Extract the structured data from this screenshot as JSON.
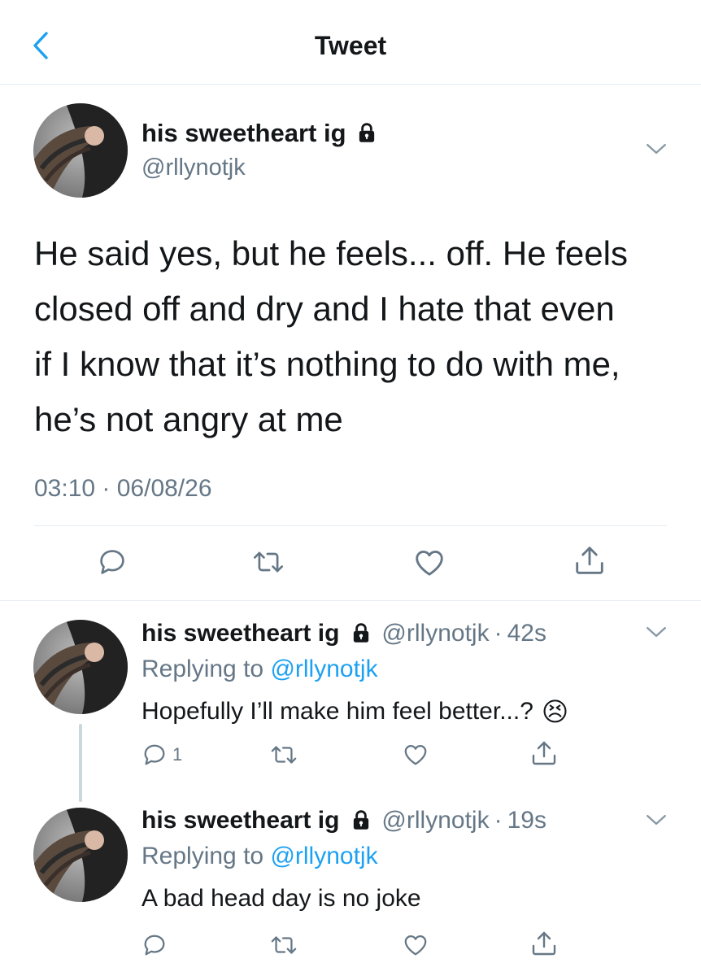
{
  "header": {
    "title": "Tweet"
  },
  "tweet": {
    "author_name": "his sweetheart ig",
    "author_handle": "@rllynotjk",
    "text": "He said yes, but he feels... off. He feels\nclosed off and dry and I hate that even\nif I know that it’s nothing to do with me,\nhe’s not angry at me",
    "timestamp": "03:10 · 06/08/26"
  },
  "replies": [
    {
      "author_name": "his sweetheart ig",
      "author_handle": "@rllynotjk",
      "dot": "·",
      "time": "42s",
      "replying_prefix": "Replying to ",
      "replying_to": "@rllynotjk",
      "text": "Hopefully I’ll make him feel better...?",
      "emoji": "😣",
      "reply_count": "1"
    },
    {
      "author_name": "his sweetheart ig",
      "author_handle": "@rllynotjk",
      "dot": "·",
      "time": "19s",
      "replying_prefix": "Replying to ",
      "replying_to": "@rllynotjk",
      "text": "A bad head day is no joke"
    }
  ],
  "colors": {
    "accent": "#1da1f2",
    "secondary_text": "#657786",
    "divider": "#e6ecf0"
  },
  "icons": [
    "back-chevron-icon",
    "lock-icon",
    "chevron-down-icon",
    "reply-icon",
    "retweet-icon",
    "like-icon",
    "share-icon"
  ]
}
